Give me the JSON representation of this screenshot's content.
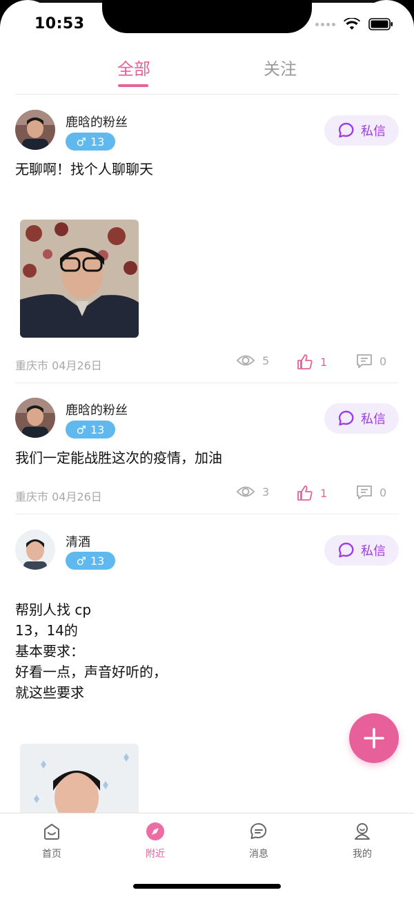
{
  "status_bar": {
    "time": "10:53"
  },
  "top_tabs": [
    {
      "label": "全部",
      "active": true
    },
    {
      "label": "关注",
      "active": false
    }
  ],
  "posts": [
    {
      "username": "鹿晗的粉丝",
      "gender_age": "13",
      "dm_label": "私信",
      "text": "无聊啊！找个人聊聊天",
      "location_date": "重庆市 04月26日",
      "views": "5",
      "likes": "1",
      "comments": "0"
    },
    {
      "username": "鹿晗的粉丝",
      "gender_age": "13",
      "dm_label": "私信",
      "text": "我们一定能战胜这次的疫情，加油",
      "location_date": "重庆市 04月26日",
      "views": "3",
      "likes": "1",
      "comments": "0"
    },
    {
      "username": "清酒",
      "gender_age": "13",
      "dm_label": "私信",
      "text": "帮别人找 cp\n13，14的\n基本要求：\n好看一点，声音好听的，\n就这些要求"
    }
  ],
  "tab_bar": [
    {
      "label": "首页",
      "icon": "home-icon"
    },
    {
      "label": "附近",
      "icon": "compass-icon",
      "active": true
    },
    {
      "label": "消息",
      "icon": "message-icon"
    },
    {
      "label": "我的",
      "icon": "profile-icon"
    }
  ],
  "colors": {
    "accent": "#e8609a",
    "badge": "#5fb8ee",
    "dm": "#9b3fe0"
  }
}
